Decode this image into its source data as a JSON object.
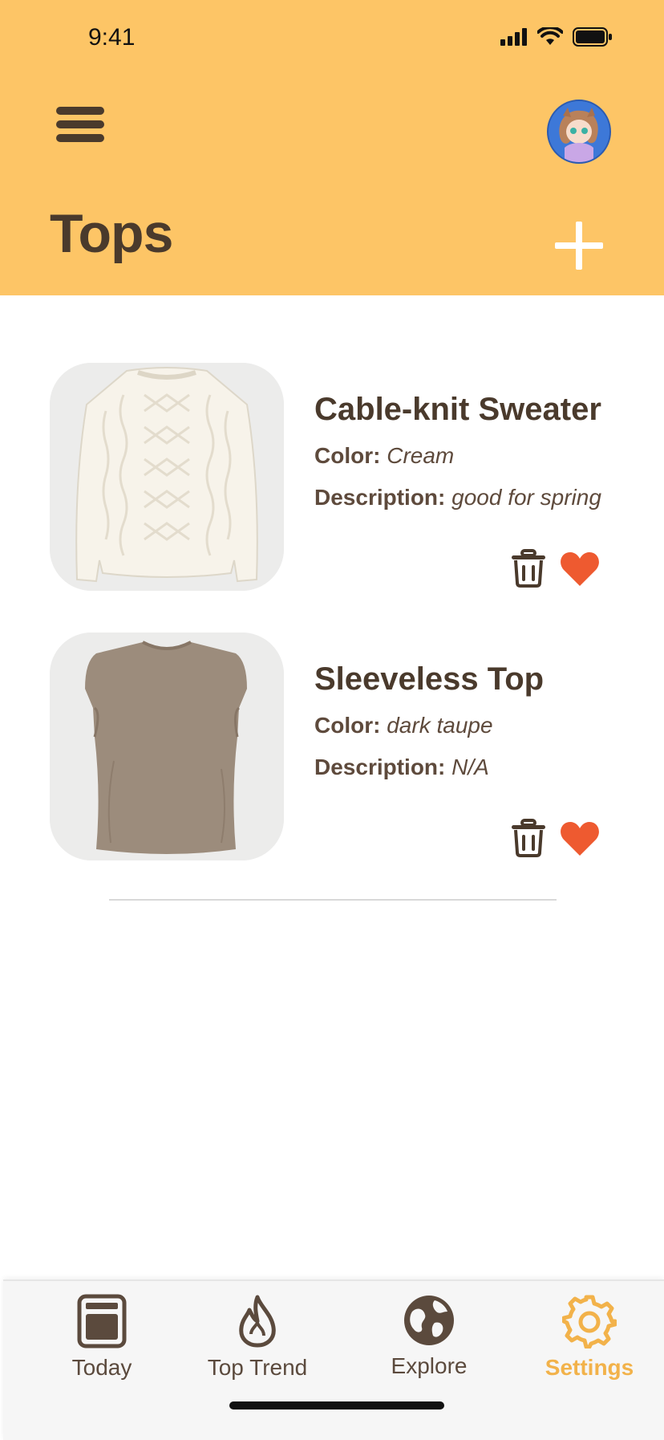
{
  "status_bar": {
    "time": "9:41"
  },
  "header": {
    "title": "Tops",
    "menu_icon": "hamburger-menu-icon",
    "add_icon": "plus-icon",
    "avatar_icon": "user-avatar"
  },
  "labels": {
    "color": "Color:",
    "description": "Description:"
  },
  "items": [
    {
      "name": "Cable-knit Sweater",
      "color": "Cream",
      "description": "good for spring"
    },
    {
      "name": "Sleeveless Top",
      "color": "dark taupe",
      "description": "N/A"
    }
  ],
  "tabs": [
    {
      "label": "Today",
      "icon": "calendar-icon"
    },
    {
      "label": "Top Trend",
      "icon": "flame-icon"
    },
    {
      "label": "Explore",
      "icon": "globe-icon"
    },
    {
      "label": "Settings",
      "icon": "gear-icon",
      "active": true
    }
  ],
  "colors": {
    "header_bg": "#fdc566",
    "accent": "#f2b24a",
    "text": "#4a3a2c",
    "heart": "#ee5a30"
  }
}
